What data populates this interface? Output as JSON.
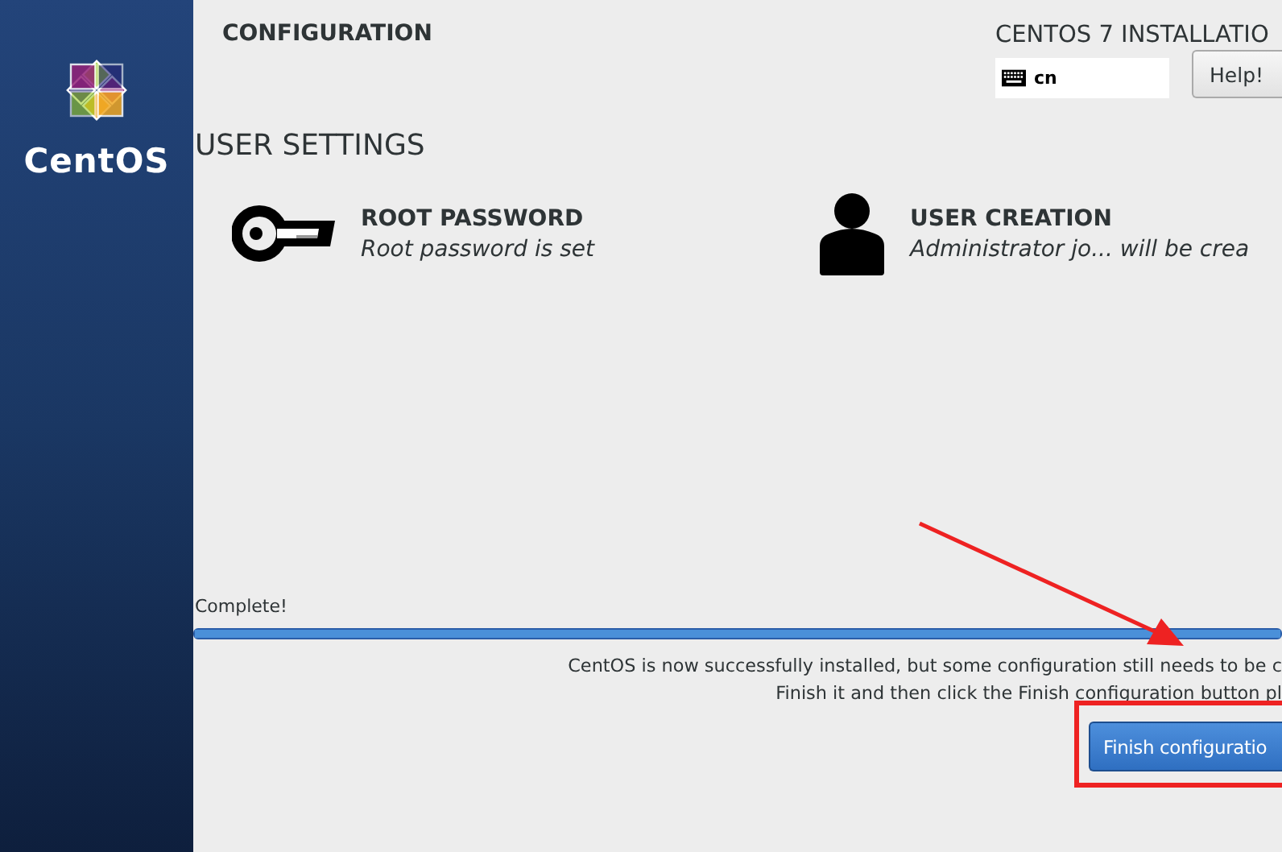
{
  "sidebar": {
    "brand": "CentOS"
  },
  "header": {
    "title": "CONFIGURATION",
    "product": "CENTOS 7 INSTALLATIO",
    "keyboard_layout": "cn",
    "help_button": "Help!"
  },
  "section": {
    "title": "USER SETTINGS",
    "spokes": [
      {
        "kind": "key",
        "title": "ROOT PASSWORD",
        "status": "Root password is set"
      },
      {
        "kind": "user",
        "title": "USER CREATION",
        "status": "Administrator jo... will be crea"
      }
    ]
  },
  "progress": {
    "label": "Complete!",
    "level": 1
  },
  "messages": [
    "CentOS is now successfully installed, but some configuration still needs to be c",
    "Finish it and then click the Finish configuration button pl"
  ],
  "finish_button": "Finish configuratio",
  "annotations": {
    "arrow": true,
    "highlight_box": true
  }
}
